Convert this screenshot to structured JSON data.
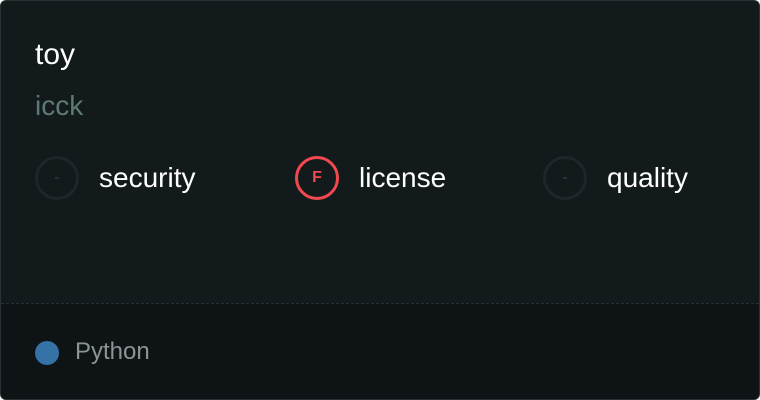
{
  "card": {
    "title": "toy",
    "subtitle": "icck"
  },
  "metrics": [
    {
      "grade": "-",
      "label": "security",
      "status": "none",
      "color": "#2b3235"
    },
    {
      "grade": "F",
      "label": "license",
      "status": "fail",
      "color": "#f2484f"
    },
    {
      "grade": "-",
      "label": "quality",
      "status": "none",
      "color": "#2b3235"
    }
  ],
  "footer": {
    "language": "Python",
    "language_color": "#3572a5"
  },
  "colors": {
    "background": "#121a1c",
    "footer_background": "#0e1416",
    "subtitle": "#5e7a75",
    "fail": "#f2484f"
  }
}
